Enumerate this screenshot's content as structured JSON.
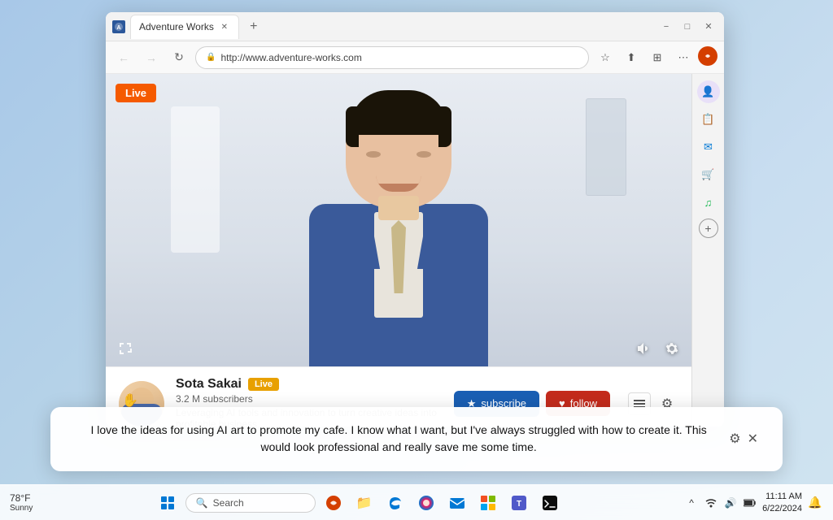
{
  "desktop": {
    "background": "light blue gradient"
  },
  "browser": {
    "tab": {
      "title": "Adventure Works",
      "favicon": "AW"
    },
    "address": "http://www.adventure-works.com",
    "window_controls": {
      "minimize": "−",
      "maximize": "□",
      "close": "✕"
    },
    "nav": {
      "back": "←",
      "forward": "→",
      "refresh": "↻",
      "new_tab": "+"
    }
  },
  "video": {
    "live_label": "Live",
    "status": "live"
  },
  "channel": {
    "name": "Sota Sakai",
    "live_pill": "Live",
    "subscribers": "3.2 M subscribers",
    "description": "Leveraging AI tools and innovation to turn creative ideas into profitable business.",
    "subscribe_btn": "subscribe",
    "follow_btn": "follow"
  },
  "copilot": {
    "message": "I love the ideas for using AI art to promote my cafe. I know what I want, but I've always struggled with how to create it. This would look professional and really save me some time."
  },
  "taskbar": {
    "weather_temp": "78°F",
    "weather_desc": "Sunny",
    "search_placeholder": "Search",
    "time": "11:11 AM",
    "date": "6/22/2024"
  },
  "sidebar": {
    "icons": [
      "👤",
      "📋",
      "✉️",
      "🛒",
      "🎵",
      "+"
    ]
  }
}
